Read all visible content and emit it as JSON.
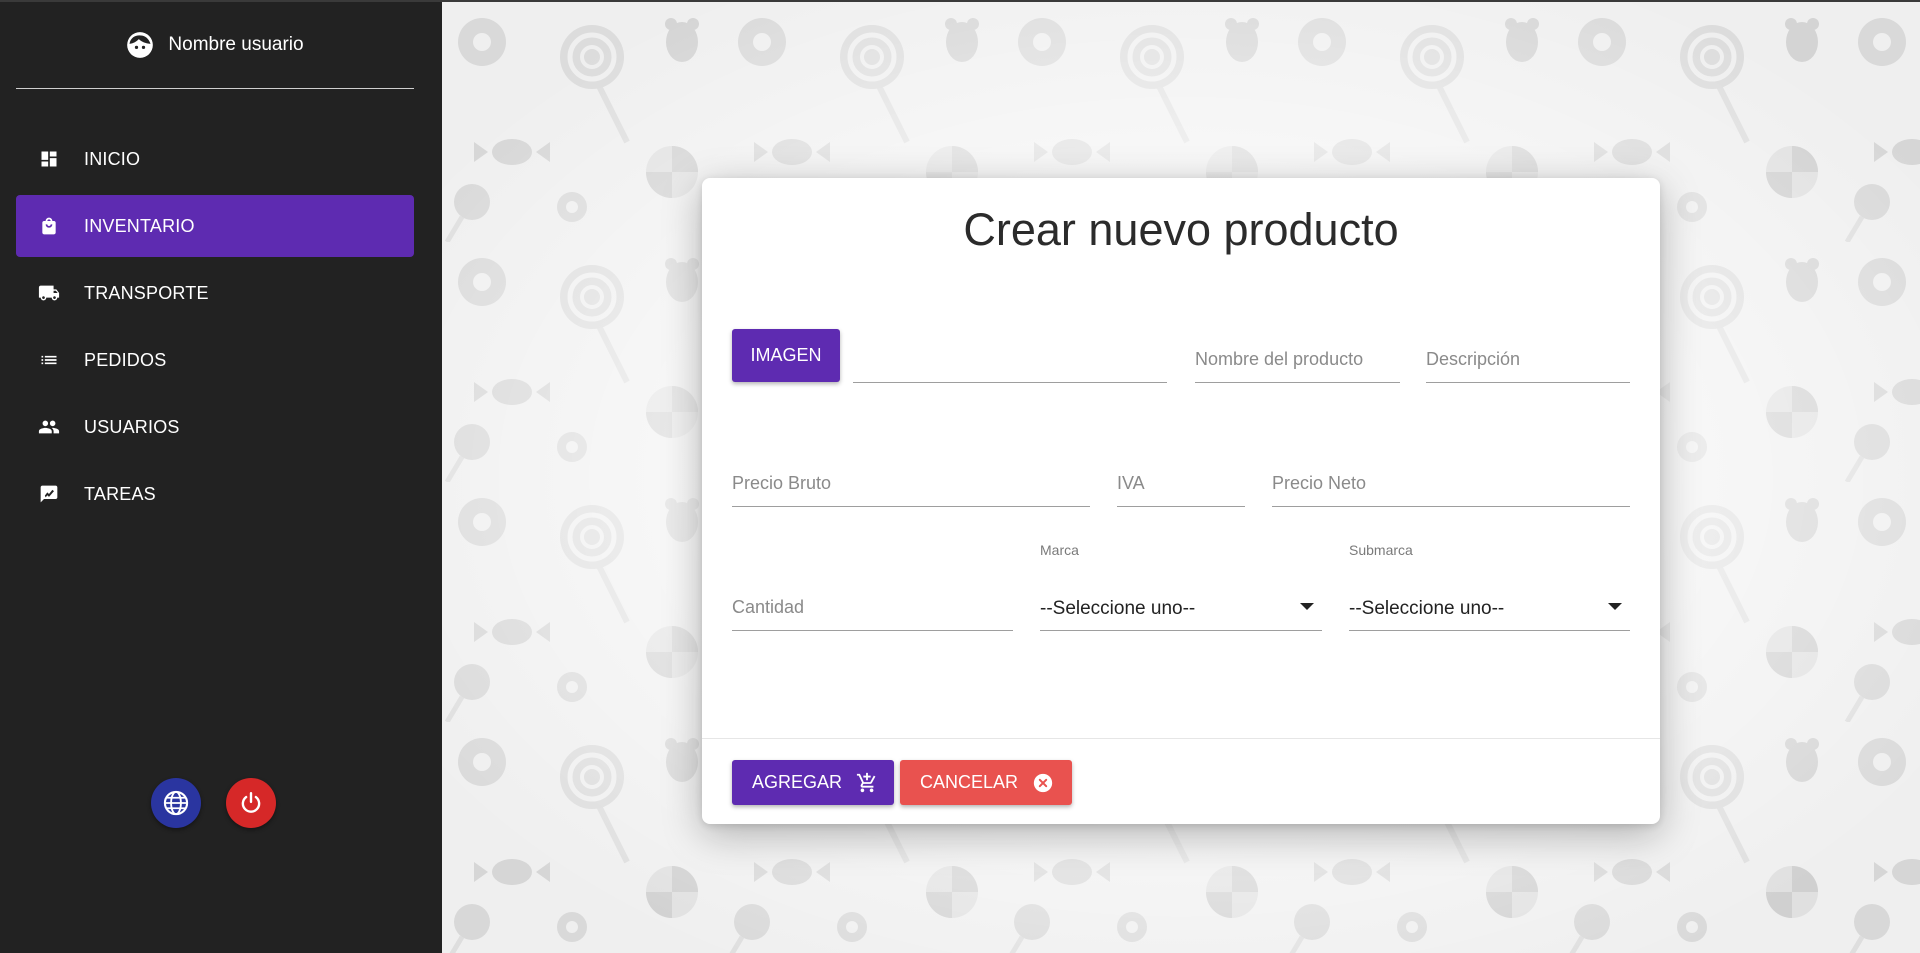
{
  "user": {
    "name": "Nombre usuario",
    "icon": "face-icon"
  },
  "sidebar": {
    "items": [
      {
        "label": "INICIO",
        "icon": "dashboard-icon",
        "active": false
      },
      {
        "label": "INVENTARIO",
        "icon": "shopping-bag-icon",
        "active": true
      },
      {
        "label": "TRANSPORTE",
        "icon": "truck-icon",
        "active": false
      },
      {
        "label": "PEDIDOS",
        "icon": "list-icon",
        "active": false
      },
      {
        "label": "USUARIOS",
        "icon": "people-icon",
        "active": false
      },
      {
        "label": "TAREAS",
        "icon": "chart-feedback-icon",
        "active": false
      }
    ],
    "bottom": {
      "language_icon": "globe-icon",
      "logout_icon": "power-icon"
    }
  },
  "form": {
    "title": "Crear nuevo producto",
    "image_button": "IMAGEN",
    "image_file_value": "",
    "nombre_placeholder": "Nombre del producto",
    "descripcion_placeholder": "Descripción",
    "precio_bruto_placeholder": "Precio Bruto",
    "iva_placeholder": "IVA",
    "precio_neto_placeholder": "Precio Neto",
    "cantidad_placeholder": "Cantidad",
    "marca": {
      "label": "Marca",
      "value": "--Seleccione uno--"
    },
    "submarca": {
      "label": "Submarca",
      "value": "--Seleccione uno--"
    },
    "add_button": "AGREGAR",
    "cancel_button": "CANCELAR"
  },
  "colors": {
    "sidebar_bg": "#222222",
    "accent": "#5e2bb1",
    "cancel": "#e9524f",
    "power": "#d62828",
    "globe": "#2a35a0"
  }
}
